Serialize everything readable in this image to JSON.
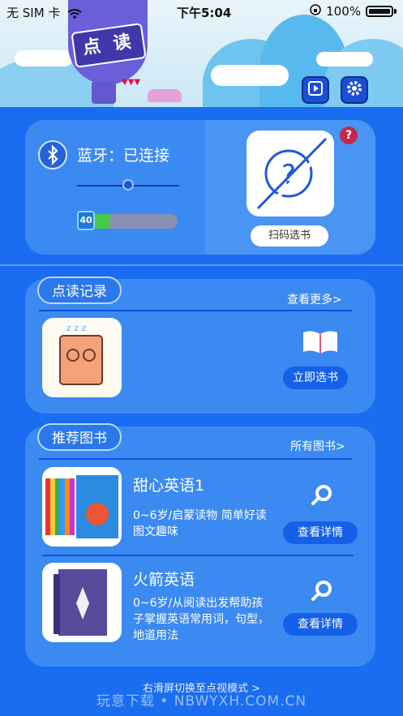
{
  "status_bar": {
    "carrier": "无 SIM 卡",
    "time": "下午5:04",
    "battery": "100%"
  },
  "header": {
    "logo_text": "点 读",
    "play_icon": "play-icon",
    "settings_icon": "gear-icon"
  },
  "bluetooth": {
    "status": "蓝牙：已连接",
    "battery_level": "40",
    "battery_fill_fraction": 0.3,
    "scan_button": "扫码选书",
    "help_badge": "?"
  },
  "history": {
    "title": "点读记录",
    "more": "查看更多>",
    "select_button": "立即选书"
  },
  "recommend": {
    "title": "推荐图书",
    "more": "所有图书>",
    "books": [
      {
        "title": "甜心英语1",
        "desc": "0~6岁/启蒙读物 简单好读 图文趣味",
        "button": "查看详情"
      },
      {
        "title": "火箭英语",
        "desc": "0~6岁/从阅读出发帮助孩子掌握英语常用词，句型，地道用法",
        "button": "查看详情"
      }
    ]
  },
  "footer": {
    "switch_text": "右滑屏切换至点视模式 >",
    "watermark": "玩意下载 • NBWYXH.COM.CN"
  }
}
